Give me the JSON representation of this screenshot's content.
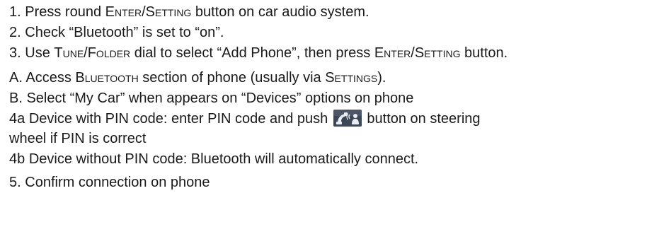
{
  "steps": {
    "s1": {
      "num": "1.",
      "text_a": "Press round ",
      "enter_setting": "Enter/Setting",
      "text_b": " button on car audio system."
    },
    "s2": {
      "num": "2.",
      "text": "Check “Bluetooth” is set to “on”."
    },
    "s3": {
      "num": "3.",
      "text_a": "Use ",
      "tune_folder": "Tune/Folder",
      "text_b": " dial to select “Add Phone”, then press ",
      "enter_setting": "Enter/Setting",
      "text_c": " button."
    },
    "sA": {
      "num": "A.",
      "text_a": "Access ",
      "bluetooth": "Bluetooth",
      "text_b": " section of phone (usually via ",
      "settings": "Settings",
      "text_c": ")."
    },
    "sB": {
      "num": "B.",
      "text": "Select “My Car” when appears on “Devices” options on phone"
    },
    "s4a": {
      "num": "4a",
      "text_a": "Device with PIN code: enter PIN code and push",
      "text_b": "button on steering",
      "text_c": "wheel if PIN is correct"
    },
    "s4b": {
      "num": "4b",
      "text": "Device without PIN code: Bluetooth will automatically connect."
    },
    "s5": {
      "num": "5.",
      "text": "Confirm connection on phone"
    }
  },
  "icons": {
    "phone_button": "phone-talk-button-icon"
  },
  "colors": {
    "text": "#1a1a1a",
    "icon_bg": "#3d4654",
    "icon_fg": "#e9eef4"
  }
}
